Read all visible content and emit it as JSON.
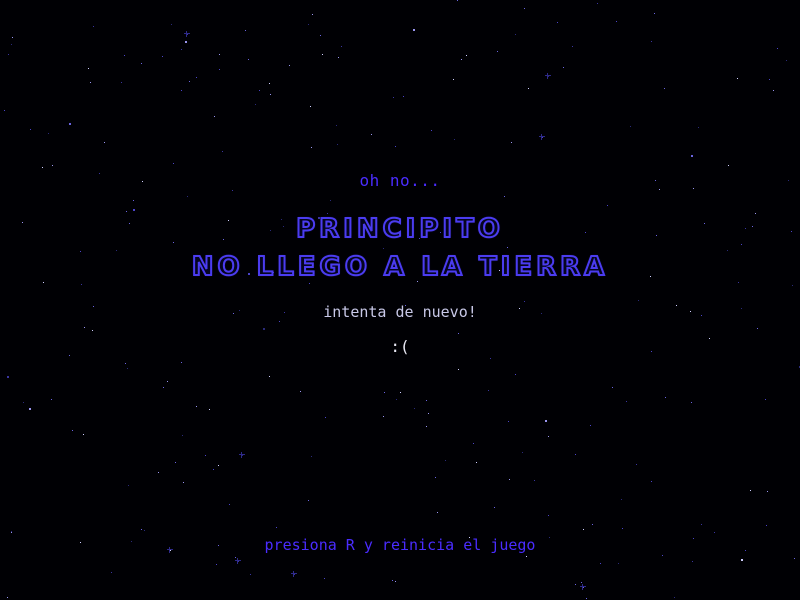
{
  "screen": {
    "subtitle": "oh no...",
    "title_line_1": "PRINCIPITO",
    "title_line_2": "NO LLEGO A LA TIERRA",
    "retry_text": "intenta de nuevo!",
    "sad_face": ":(",
    "restart_hint": "presiona R y reinicia el juego"
  },
  "colors": {
    "background": "#000004",
    "accent": "#4a2cff",
    "title_outline": "#4b3cf0",
    "body_text": "#c8c8e8"
  },
  "icons": [
    "starfield-background"
  ]
}
